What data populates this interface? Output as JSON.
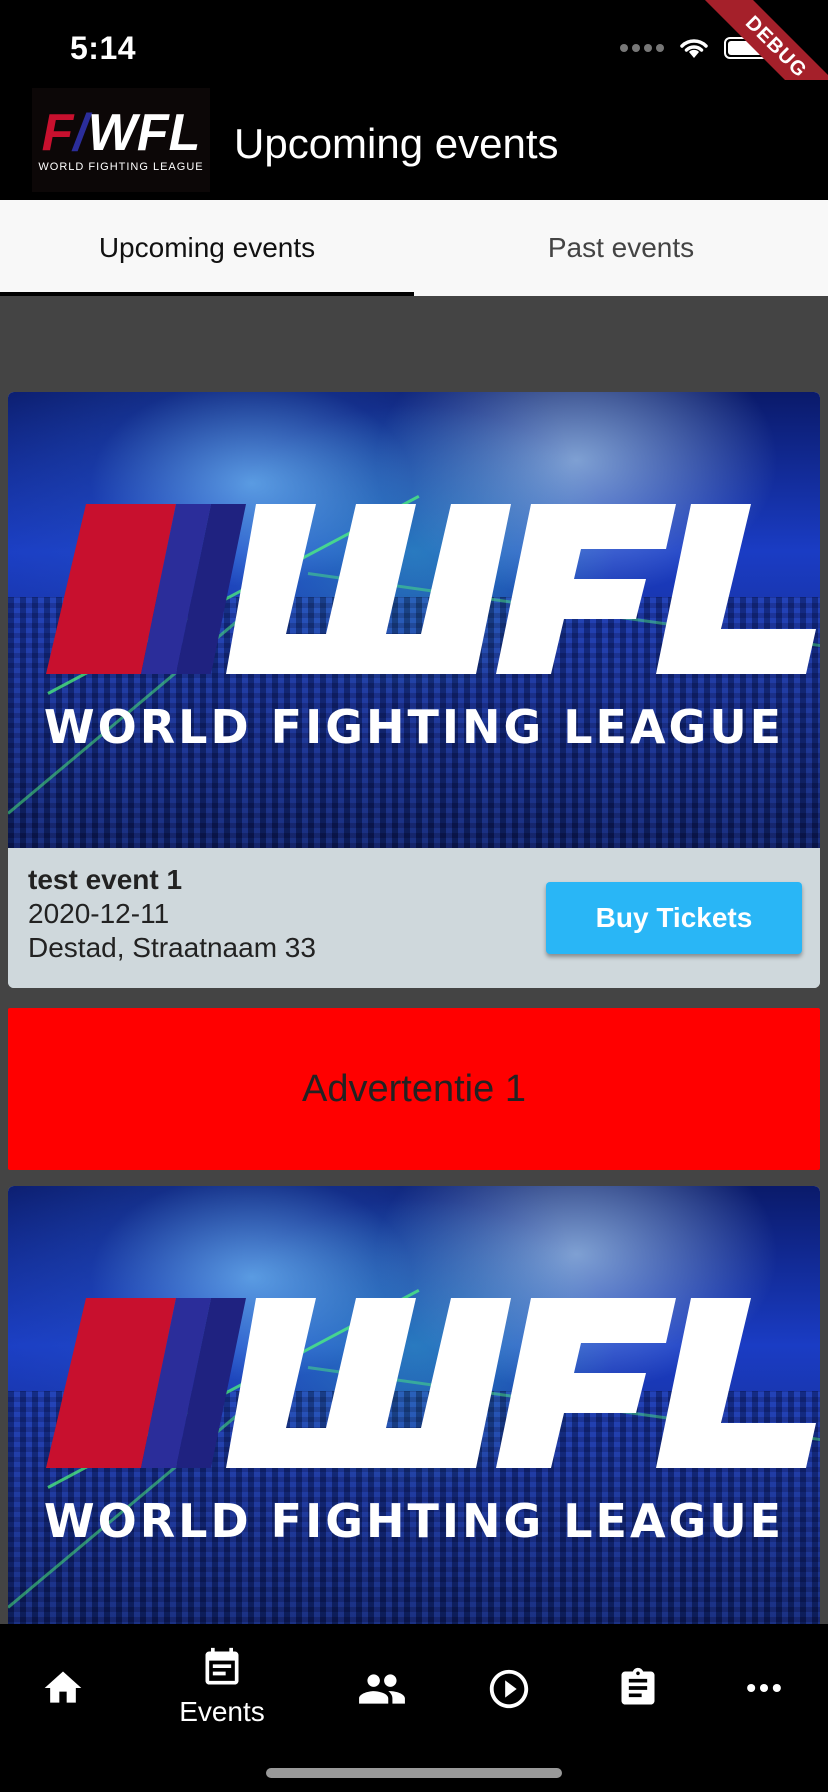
{
  "status_bar": {
    "time": "5:14"
  },
  "debug_banner": {
    "label": "DEBUG"
  },
  "app_bar": {
    "title": "Upcoming events",
    "logo": {
      "mark": "WFL",
      "tagline": "WORLD FIGHTING LEAGUE"
    }
  },
  "tabs": [
    {
      "label": "Upcoming events",
      "active": true
    },
    {
      "label": "Past events",
      "active": false
    }
  ],
  "events": [
    {
      "image_logo_tagline": "WORLD FIGHTING LEAGUE",
      "name": "test event 1",
      "date": "2020-12-11",
      "address": "Destad, Straatnaam 33",
      "button_label": "Buy Tickets"
    },
    {
      "image_logo_tagline": "WORLD FIGHTING LEAGUE"
    }
  ],
  "ad": {
    "label": "Advertentie 1"
  },
  "bottom_nav": {
    "items": [
      {
        "icon": "home-icon",
        "label": ""
      },
      {
        "icon": "events-icon",
        "label": "Events"
      },
      {
        "icon": "people-icon",
        "label": ""
      },
      {
        "icon": "play-icon",
        "label": ""
      },
      {
        "icon": "clipboard-icon",
        "label": ""
      },
      {
        "icon": "more-icon",
        "label": ""
      }
    ]
  },
  "colors": {
    "accent_button": "#29b6f6",
    "ad_background": "#ff0000",
    "card_info_background": "#cfd8dc",
    "logo_red": "#c8102e",
    "logo_blue": "#2b2d9a"
  }
}
